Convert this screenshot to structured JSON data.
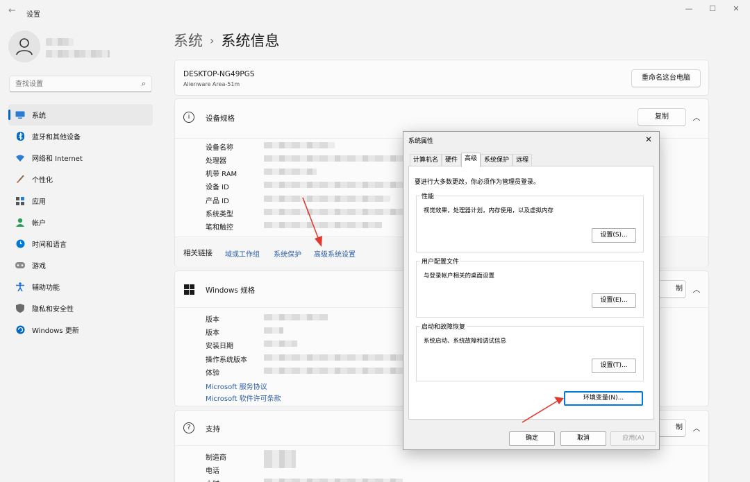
{
  "window": {
    "title": "设置",
    "back_icon": "back-arrow-icon",
    "controls": [
      "—",
      "☐",
      "✕"
    ]
  },
  "search": {
    "placeholder": "查找设置"
  },
  "sidebar": {
    "items": [
      {
        "label": "系统",
        "icon": "monitor-icon",
        "color": "#0067c0"
      },
      {
        "label": "蓝牙和其他设备",
        "icon": "bluetooth-icon",
        "color": "#0067c0"
      },
      {
        "label": "网络和 Internet",
        "icon": "wifi-icon",
        "color": "#2b7cd3"
      },
      {
        "label": "个性化",
        "icon": "brush-icon",
        "color": "#c46b2a"
      },
      {
        "label": "应用",
        "icon": "apps-icon",
        "color": "#555555"
      },
      {
        "label": "帐户",
        "icon": "person-icon",
        "color": "#2a9d5a"
      },
      {
        "label": "时间和语言",
        "icon": "globe-clock-icon",
        "color": "#0078d4"
      },
      {
        "label": "游戏",
        "icon": "gamepad-icon",
        "color": "#7a7a7a"
      },
      {
        "label": "辅助功能",
        "icon": "accessibility-icon",
        "color": "#1f6fd0"
      },
      {
        "label": "隐私和安全性",
        "icon": "shield-icon",
        "color": "#6b6b6b"
      },
      {
        "label": "Windows 更新",
        "icon": "update-icon",
        "color": "#0067c0"
      }
    ]
  },
  "breadcrumb": {
    "parent": "系统",
    "separator": "›",
    "current": "系统信息"
  },
  "device": {
    "name": "DESKTOP-NG49PGS",
    "model": "Alienware Area-51m",
    "rename_button": "重命名这台电脑"
  },
  "device_specs": {
    "title": "设备规格",
    "copy_button": "复制",
    "labels": [
      "设备名称",
      "处理器",
      "机带 RAM",
      "设备 ID",
      "产品 ID",
      "系统类型",
      "笔和触控"
    ]
  },
  "related_links": {
    "label": "相关链接",
    "links": [
      "域或工作组",
      "系统保护",
      "高级系统设置"
    ]
  },
  "windows_specs": {
    "title": "Windows 规格",
    "copy_button_partial": "制",
    "labels": [
      "版本",
      "版本",
      "安装日期",
      "操作系统版本",
      "体验"
    ],
    "links": [
      "Microsoft 服务协议",
      "Microsoft 软件许可条款"
    ]
  },
  "support": {
    "title": "支持",
    "copy_button_partial": "制",
    "labels": [
      "制造商",
      "电话",
      "小时"
    ]
  },
  "dialog": {
    "title": "系统属性",
    "tabs": [
      "计算机名",
      "硬件",
      "高级",
      "系统保护",
      "远程"
    ],
    "active_tab": "高级",
    "admin_note": "要进行大多数更改，你必须作为管理员登录。",
    "groups": [
      {
        "title": "性能",
        "desc": "视觉效果，处理器计划，内存使用，以及虚拟内存",
        "button": "设置(S)..."
      },
      {
        "title": "用户配置文件",
        "desc": "与登录帐户相关的桌面设置",
        "button": "设置(E)..."
      },
      {
        "title": "启动和故障恢复",
        "desc": "系统启动、系统故障和调试信息",
        "button": "设置(T)..."
      }
    ],
    "env_button": "环境变量(N)...",
    "ok_button": "确定",
    "cancel_button": "取消",
    "apply_button": "应用(A)"
  },
  "annotation_color": "#e03a2f"
}
